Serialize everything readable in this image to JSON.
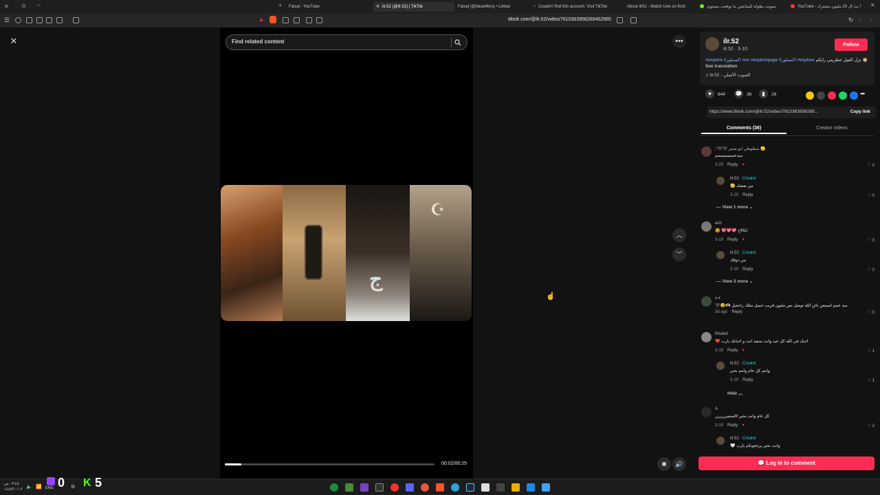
{
  "browser": {
    "tabs": [
      {
        "title": "Faisal - YouTube",
        "active": false
      },
      {
        "title": "ilr.52 (@ilr.52) | TikTok",
        "active": true
      },
      {
        "title": "Faisal (@faisal4bro) • Linkac",
        "active": false
      },
      {
        "title": "Couldn't find this account. Visit TikTok",
        "active": false
      },
      {
        "title": "About ilr52 - Watch Live on Kick",
        "active": false
      },
      {
        "title": "سويت بطولة للمتابعين ما توقعت مستوى",
        "active": false
      },
      {
        "title": "YouTube - بث ال 20 مليون مشترك !",
        "active": false
      }
    ],
    "url": "tiktok.com/@ilr.52/video/7615363956269452565"
  },
  "video": {
    "search_placeholder": "Find related content",
    "time": "00:02/00:25",
    "progress": 0.08
  },
  "sidebar": {
    "username": "ilr.52",
    "meta": "ilr.52 · 3-10",
    "follow_label": "Follow",
    "caption_text": "نزل الفيل عطريني رايكم 👏🏼",
    "caption_tags": "#explore #اكسبلور #ex #explorepage #اكسبلور #explore",
    "see_translation": "See translation",
    "music": "ilr.52 - الصوت الأصلي",
    "likes": "644",
    "comments_count": "36",
    "saves": "26",
    "link": "https://www.tiktok.com/@ilr.52/video/7615363956269...",
    "copy_link": "Copy link",
    "tab_comments": "Comments (36)",
    "tab_creator_videos": "Creator videos",
    "login_label": "Log in to comment"
  },
  "comments": [
    {
      "name": "🕯 🖤🖤 سطوطي ابو شمر 🫡",
      "text": "ميدعمممممممم",
      "date": "3-20",
      "likes": "2",
      "reply_label": "Reply"
    },
    {
      "name": "ilr.52",
      "creator": "· Creator",
      "text": "من بعضك 🫡",
      "date": "3-20",
      "likes": "0",
      "reply_label": "Reply"
    },
    {
      "view_more": "View 1 more"
    },
    {
      "name": "ash",
      "text": "ايااااخ 💖💖💖 😍",
      "date": "3-19",
      "likes": "3",
      "reply_label": "Reply"
    },
    {
      "name": "ilr.52",
      "creator": "· Creator",
      "text": "من ذوقك",
      "date": "3-19",
      "likes": "2",
      "reply_label": "Reply"
    },
    {
      "view_more": "View 2 more"
    },
    {
      "name": "ᴀ.x",
      "text": "ميد عمم اسمعن بائن الله توصل نص مليون قريب جميل مثلك راجعيل 🫶🏻😂🖤",
      "date": "3d ago",
      "likes": "0",
      "reply_label": "Reply"
    },
    {
      "name": "Khaled",
      "text": "احبك في الله كل عيد وانت سعيد انت و احبابك يارب ❤️",
      "date": "3-19",
      "likes": "1",
      "reply_label": "Reply"
    },
    {
      "name": "ilr.52",
      "creator": "· Creator",
      "text": "وانتم كل عام وانتم بخير",
      "date": "3-19",
      "likes": "1",
      "reply_label": "Reply"
    },
    {
      "hide": "Hide"
    },
    {
      "name": "A",
      "text": "كل عام وانت بخير #استمرررررر",
      "date": "3-19",
      "likes": "2",
      "reply_label": "Reply"
    },
    {
      "name": "ilr.52",
      "creator": "· Creator",
      "text": "وانت بخير يرجعونكم يارب 🤍",
      "date": "",
      "likes": "",
      "reply_label": ""
    }
  ],
  "taskbar": {
    "time": "٠٣:٤٨ ص",
    "date": "١٤٤٧/١٠/٠٢",
    "lang": "ENG",
    "widget_a": "0",
    "widget_b": "5"
  },
  "colors": {
    "accent": "#fe2c55",
    "creator": "#25d1da",
    "tag": "#8ab4ff"
  }
}
